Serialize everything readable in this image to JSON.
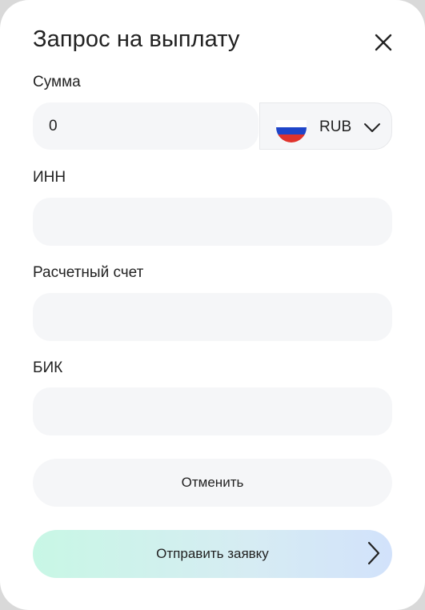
{
  "dialog": {
    "title": "Запрос на выплату"
  },
  "fields": {
    "amount_label": "Сумма",
    "amount_value": "0",
    "inn_label": "ИНН",
    "inn_value": "",
    "account_label": "Расчетный счет",
    "account_value": "",
    "bik_label": "БИК",
    "bik_value": ""
  },
  "currency": {
    "code": "RUB",
    "flag": "russia-flag-icon"
  },
  "buttons": {
    "cancel": "Отменить",
    "submit": "Отправить заявку"
  },
  "colors": {
    "field_bg": "#f5f6f8",
    "submit_gradient_start": "#c8f7e5",
    "submit_gradient_end": "#d2e2fb",
    "text": "#222222"
  }
}
